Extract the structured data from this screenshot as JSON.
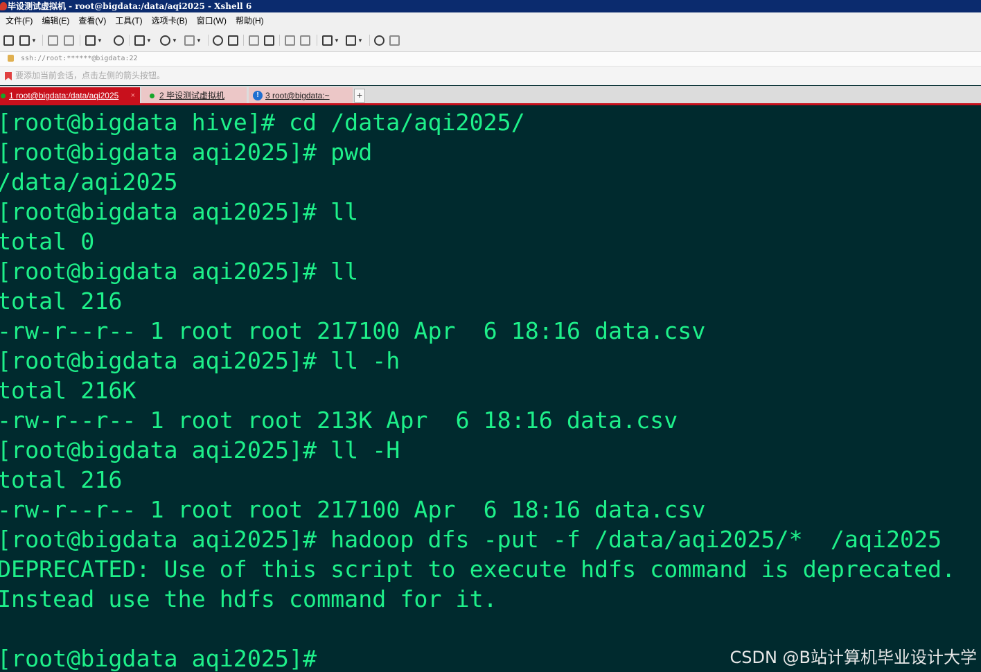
{
  "window": {
    "title": "毕设测试虚拟机 - root@bigdata:/data/aqi2025 - Xshell 6"
  },
  "menu": [
    "文件(F)",
    "编辑(E)",
    "查看(V)",
    "工具(T)",
    "选项卡(B)",
    "窗口(W)",
    "帮助(H)"
  ],
  "toolbar": {
    "icons": [
      "new-session-icon",
      "open-folder-icon",
      "reconnect-icon",
      "disconnect-icon",
      "properties-icon",
      "find-icon",
      "transfer-icon",
      "globe-icon",
      "font-icon",
      "color-scheme-icon",
      "screenshot-icon",
      "fullscreen-icon",
      "lock-icon",
      "keyboard-icon",
      "compose-icon",
      "new-tab-icon",
      "layout-icon",
      "help-icon",
      "chat-icon"
    ]
  },
  "address": {
    "url": "ssh://root:******@bigdata:22"
  },
  "hint": {
    "text": "要添加当前会话，点击左侧的箭头按钮。"
  },
  "tabs": [
    {
      "label": "1 root@bigdata:/data/aqi2025",
      "status": "connected"
    },
    {
      "label": "2 毕设测试虚拟机",
      "status": "connected"
    },
    {
      "label": "3 root@bigdata:~",
      "status": "info"
    }
  ],
  "tab_close": "×",
  "tab_add": "+",
  "terminal": {
    "lines": [
      "[root@bigdata hive]# cd /data/aqi2025/",
      "[root@bigdata aqi2025]# pwd",
      "/data/aqi2025",
      "[root@bigdata aqi2025]# ll",
      "total 0",
      "[root@bigdata aqi2025]# ll",
      "total 216",
      "-rw-r--r-- 1 root root 217100 Apr  6 18:16 data.csv",
      "[root@bigdata aqi2025]# ll -h",
      "total 216K",
      "-rw-r--r-- 1 root root 213K Apr  6 18:16 data.csv",
      "[root@bigdata aqi2025]# ll -H",
      "total 216",
      "-rw-r--r-- 1 root root 217100 Apr  6 18:16 data.csv",
      "[root@bigdata aqi2025]# hadoop dfs -put -f /data/aqi2025/*  /aqi2025",
      "DEPRECATED: Use of this script to execute hdfs command is deprecated.",
      "Instead use the hdfs command for it.",
      "",
      "[root@bigdata aqi2025]#"
    ]
  },
  "watermark": "CSDN @B站计算机毕业设计大学",
  "colors": {
    "terminal_bg": "#002a2e",
    "terminal_fg": "#1ef08a",
    "active_tab": "#c8101c",
    "title_bar": "#0b2b6e"
  }
}
